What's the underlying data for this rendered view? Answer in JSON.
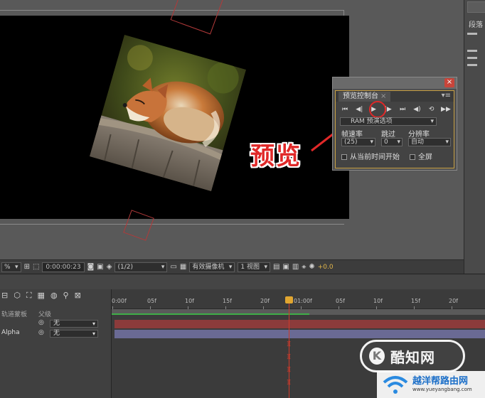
{
  "right_panel": {
    "tab_label": "段落"
  },
  "preview_panel": {
    "tab_title": "预览控制台",
    "tab_close": "×",
    "panel_menu": "▾≡",
    "close_glyph": "×",
    "transport": [
      "⏮",
      "◀|",
      "▶",
      "|▶",
      "⏭",
      "◀)",
      "⟲",
      "▶▶"
    ],
    "ram_preview_options": "RAM 预演选项",
    "frame_rate_label": "帧速率",
    "skip_label": "跳过",
    "resolution_label": "分辨率",
    "frame_rate_value": "(25)",
    "skip_value": "0",
    "resolution_value": "自动",
    "from_current_time": "从当前时间开始",
    "full_screen": "全屏"
  },
  "callout": {
    "label": "预览"
  },
  "viewer_toolbar": {
    "zoom_value": "%",
    "timecode": "0:00:00:23",
    "resolution": "(1/2)",
    "camera": "有效摄像机",
    "views": "1 视图",
    "exposure": "+0.0"
  },
  "timeline": {
    "col_mode": "轨道蒙板",
    "col_parent": "父级",
    "layers": [
      {
        "name": "",
        "parent": "无"
      },
      {
        "name": "Alpha",
        "parent": "无"
      }
    ],
    "ruler": [
      "0:00f",
      "05f",
      "10f",
      "15f",
      "20f",
      "01:00f",
      "05f",
      "10f",
      "15f",
      "20f"
    ]
  },
  "watermarks": {
    "kuzhi_logo": "K",
    "kuzhi": "酷知网",
    "router_name": "越洋帮路由网",
    "router_url": "www.yueyangbang.com"
  },
  "colors": {
    "accent_red": "#e02828",
    "panel_gold": "#c9a043",
    "track_red": "#8c3b3b",
    "track_purple": "#6a6a94",
    "work_area_green": "#3fae48",
    "cti_orange": "#e1a630"
  }
}
